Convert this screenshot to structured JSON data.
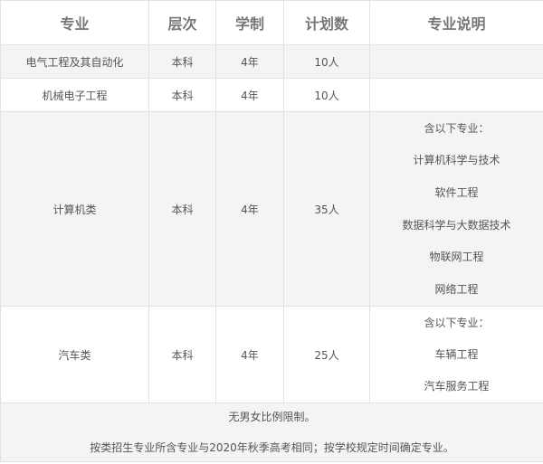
{
  "table": {
    "headers": [
      "专业",
      "层次",
      "学制",
      "计划数",
      "专业说明"
    ],
    "rows": [
      {
        "major": "电气工程及其自动化",
        "level": "本科",
        "duration": "4年",
        "quota": "10人",
        "desc": []
      },
      {
        "major": "机械电子工程",
        "level": "本科",
        "duration": "4年",
        "quota": "10人",
        "desc": []
      },
      {
        "major": "计算机类",
        "level": "本科",
        "duration": "4年",
        "quota": "35人",
        "desc": [
          "含以下专业：",
          "计算机科学与技术",
          "软件工程",
          "数据科学与大数据技术",
          "物联网工程",
          "网络工程"
        ]
      },
      {
        "major": "汽车类",
        "level": "本科",
        "duration": "4年",
        "quota": "25人",
        "desc": [
          "含以下专业：",
          "车辆工程",
          "汽车服务工程"
        ]
      }
    ],
    "notes": [
      "无男女比例限制。",
      "按类招生专业所含专业与2020年秋季高考相同；按学校规定时间确定专业。"
    ]
  }
}
